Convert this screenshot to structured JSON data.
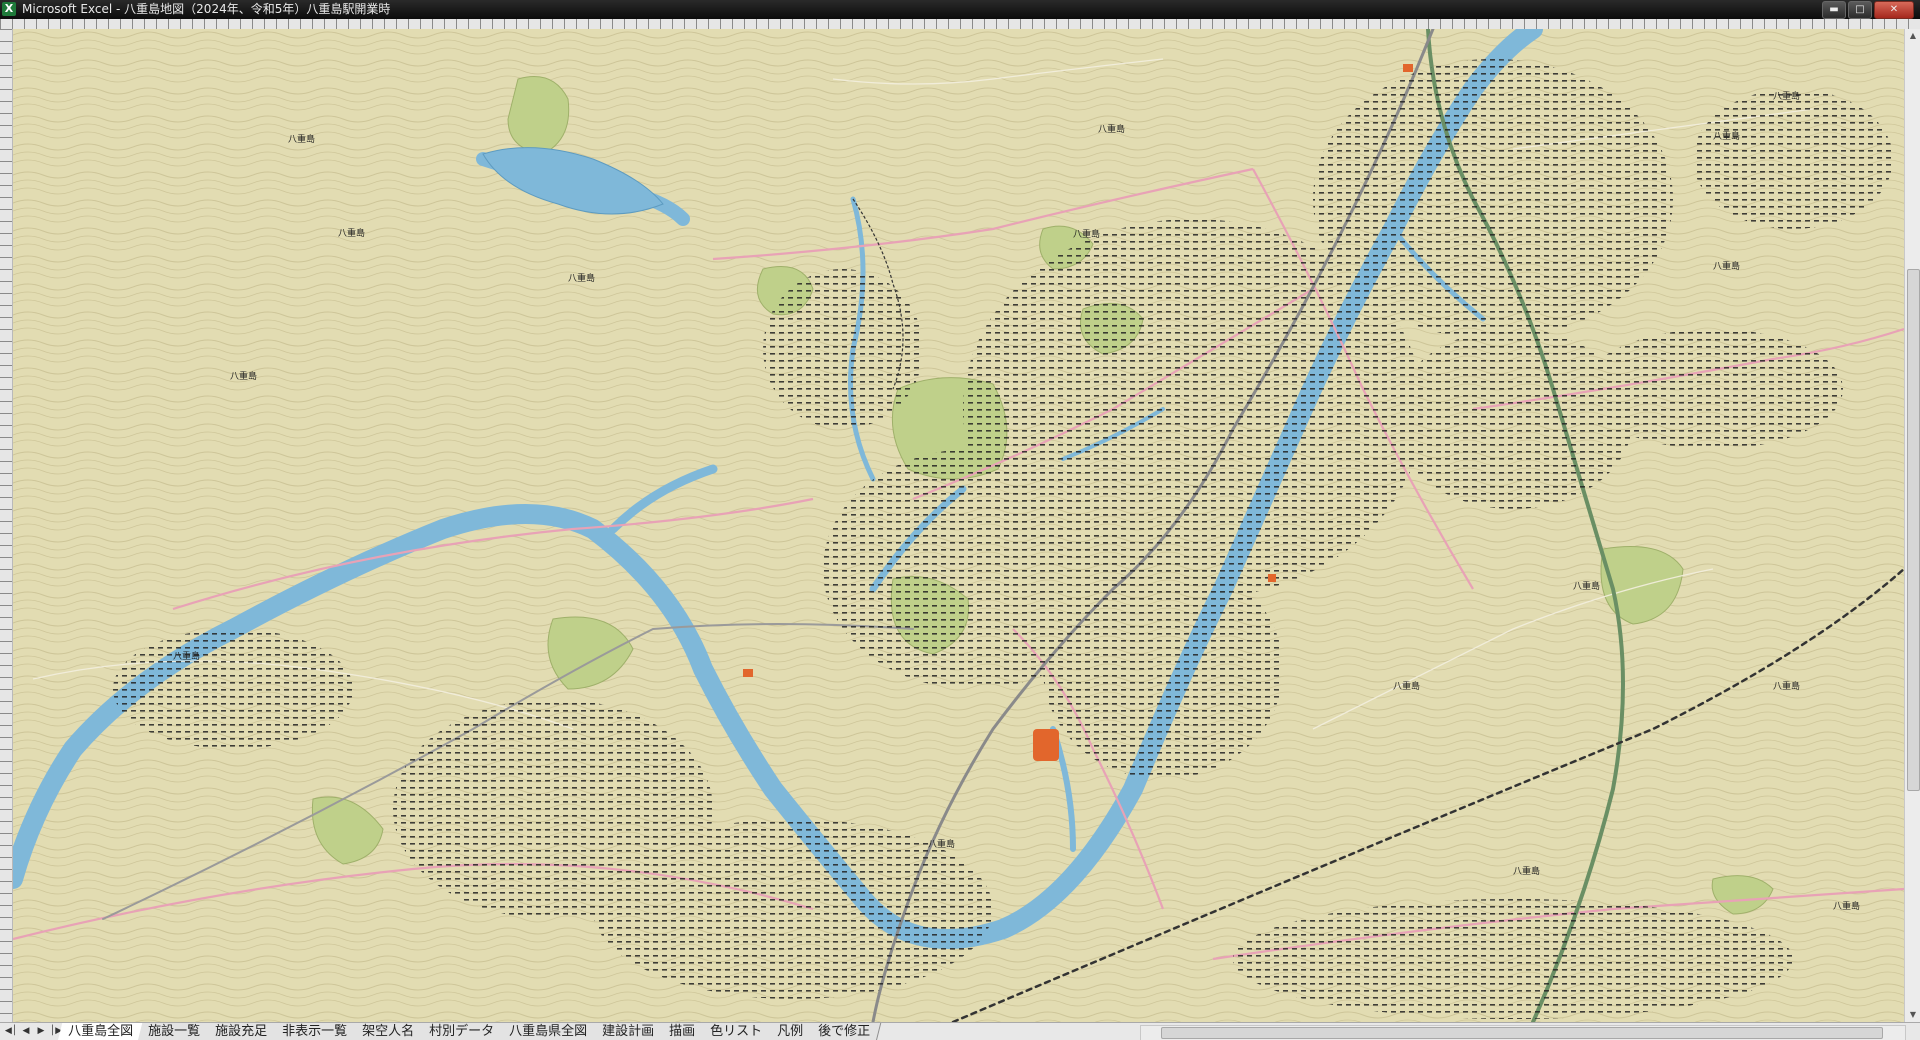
{
  "window": {
    "title": "Microsoft Excel - 八重島地図（2024年、令和5年）八重島駅開業時",
    "app_icon": "X",
    "controls": [
      "minimize-icon",
      "maximize-icon",
      "close-icon"
    ]
  },
  "map": {
    "land_color": "#e2dcb2",
    "river_color": "#7fb8d9",
    "park_color": "#bfd08a",
    "rail_color": "#6a8f64",
    "road_color": "#e8a2b6",
    "boundary_color": "#3a3a3a",
    "contour_color": "#c9c095"
  },
  "sheet_tabs": {
    "nav": [
      "first-sheet-icon",
      "prev-sheet-icon",
      "next-sheet-icon",
      "last-sheet-icon"
    ],
    "tabs": [
      {
        "label": "八重島全図",
        "active": true
      },
      {
        "label": "施設一覧",
        "active": false
      },
      {
        "label": "施設充足",
        "active": false
      },
      {
        "label": "非表示一覧",
        "active": false
      },
      {
        "label": "架空人名",
        "active": false
      },
      {
        "label": "村別データ",
        "active": false
      },
      {
        "label": "八重島県全図",
        "active": false
      },
      {
        "label": "建設計画",
        "active": false
      },
      {
        "label": "描画",
        "active": false
      },
      {
        "label": "色リスト",
        "active": false
      },
      {
        "label": "凡例",
        "active": false
      },
      {
        "label": "後で修正",
        "active": false
      }
    ]
  }
}
